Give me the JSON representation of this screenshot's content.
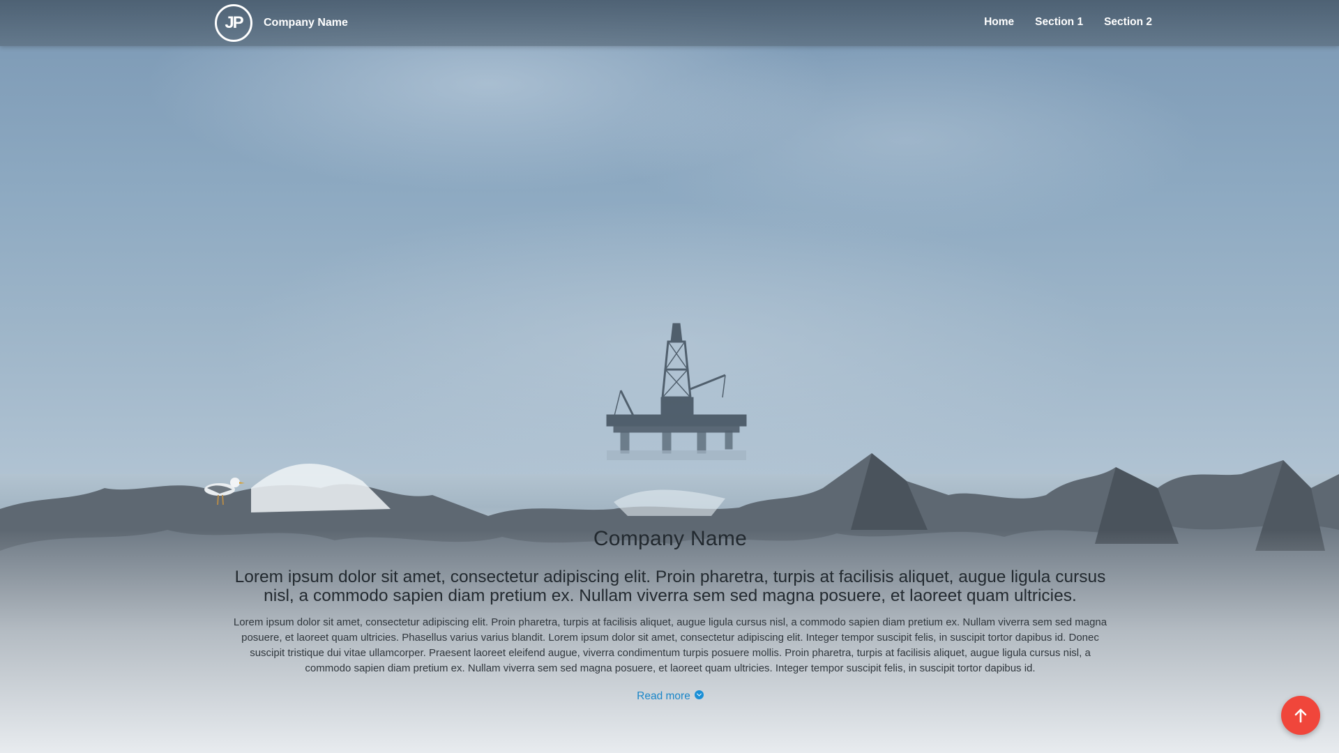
{
  "navbar": {
    "logo_text": "JP",
    "brand_name": "Company Name",
    "links": [
      {
        "label": "Home"
      },
      {
        "label": "Section 1"
      },
      {
        "label": "Section 2"
      }
    ]
  },
  "hero": {
    "title": "Company Name",
    "lead": "Lorem ipsum dolor sit amet, consectetur adipiscing elit. Proin pharetra, turpis at facilisis aliquet, augue ligula cursus nisl, a commodo sapien diam pretium ex. Nullam viverra sem sed magna posuere, et laoreet quam ultricies.",
    "body": "Lorem ipsum dolor sit amet, consectetur adipiscing elit. Proin pharetra, turpis at facilisis aliquet, augue ligula cursus nisl, a commodo sapien diam pretium ex. Nullam viverra sem sed magna posuere, et laoreet quam ultricies. Phasellus varius varius blandit. Lorem ipsum dolor sit amet, consectetur adipiscing elit. Integer tempor suscipit felis, in suscipit tortor dapibus id. Donec suscipit tristique dui vitae ullamcorper. Praesent laoreet eleifend augue, viverra condimentum turpis posuere mollis. Proin pharetra, turpis at facilisis aliquet, augue ligula cursus nisl, a commodo sapien diam pretium ex. Nullam viverra sem sed magna posuere, et laoreet quam ultricies. Integer tempor suscipit felis, in suscipit tortor dapibus id.",
    "read_more_label": "Read more",
    "background": "foggy sea with offshore oil rig, rocky shore and seagull"
  },
  "icons": {
    "read_more": "chevron-down-circle-icon",
    "back_to_top": "arrow-up-icon"
  },
  "colors": {
    "link": "#1a86c8",
    "back_to_top": "#f0463b",
    "nav_text": "#ffffff"
  }
}
